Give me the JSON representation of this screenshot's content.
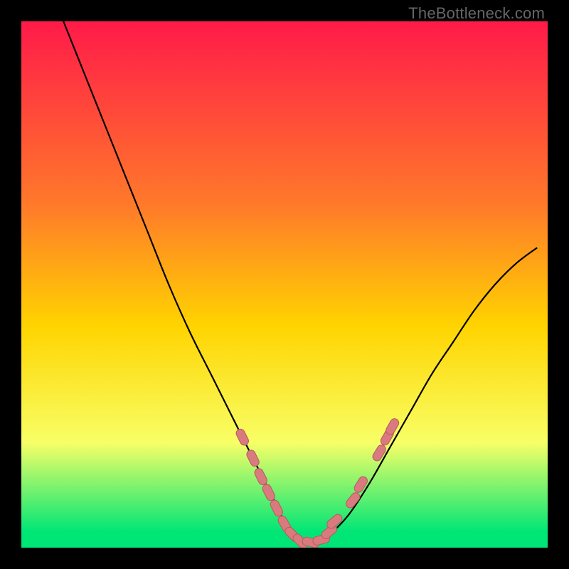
{
  "watermark": "TheBottleneck.com",
  "colors": {
    "bg": "#000000",
    "gradient_top": "#ff1a49",
    "gradient_mid_upper": "#ff7a2a",
    "gradient_mid": "#ffd400",
    "gradient_lower": "#f8ff66",
    "gradient_bottom": "#00e676",
    "curve": "#000000",
    "bead_fill": "#d87a7e",
    "bead_stroke": "#b85a5e"
  },
  "chart_data": {
    "type": "line",
    "title": "",
    "xlabel": "",
    "ylabel": "",
    "xlim": [
      0,
      100
    ],
    "ylim": [
      0,
      100
    ],
    "series": [
      {
        "name": "bottleneck-curve",
        "x": [
          8,
          12,
          16,
          20,
          24,
          28,
          32,
          36,
          40,
          44,
          46,
          48,
          50,
          52,
          54,
          56,
          58,
          62,
          66,
          70,
          74,
          78,
          82,
          86,
          90,
          94,
          98
        ],
        "values": [
          100,
          90,
          80,
          70,
          60,
          50,
          41,
          33,
          25,
          17,
          13,
          9,
          5,
          2,
          1,
          1,
          2,
          6,
          12,
          19,
          26,
          33,
          39,
          45,
          50,
          54,
          57
        ]
      }
    ],
    "beads": [
      {
        "x": 42,
        "y": 21
      },
      {
        "x": 44,
        "y": 17
      },
      {
        "x": 45.5,
        "y": 13.5
      },
      {
        "x": 47,
        "y": 10.5
      },
      {
        "x": 48.5,
        "y": 7.5
      },
      {
        "x": 50,
        "y": 4.5
      },
      {
        "x": 51.5,
        "y": 2.5
      },
      {
        "x": 53,
        "y": 1.2
      },
      {
        "x": 55,
        "y": 1.0
      },
      {
        "x": 57,
        "y": 1.5
      },
      {
        "x": 58.5,
        "y": 3
      },
      {
        "x": 59.5,
        "y": 5
      },
      {
        "x": 63,
        "y": 9
      },
      {
        "x": 64.5,
        "y": 12
      },
      {
        "x": 68,
        "y": 18
      },
      {
        "x": 69.5,
        "y": 21
      },
      {
        "x": 70.5,
        "y": 23
      }
    ],
    "gradient_bands": [
      {
        "y": 0,
        "color_key": "gradient_top"
      },
      {
        "y": 35,
        "color_key": "gradient_mid_upper"
      },
      {
        "y": 58,
        "color_key": "gradient_mid"
      },
      {
        "y": 80,
        "color_key": "gradient_lower"
      },
      {
        "y": 97,
        "color_key": "gradient_bottom"
      },
      {
        "y": 100,
        "color_key": "gradient_bottom"
      }
    ]
  }
}
